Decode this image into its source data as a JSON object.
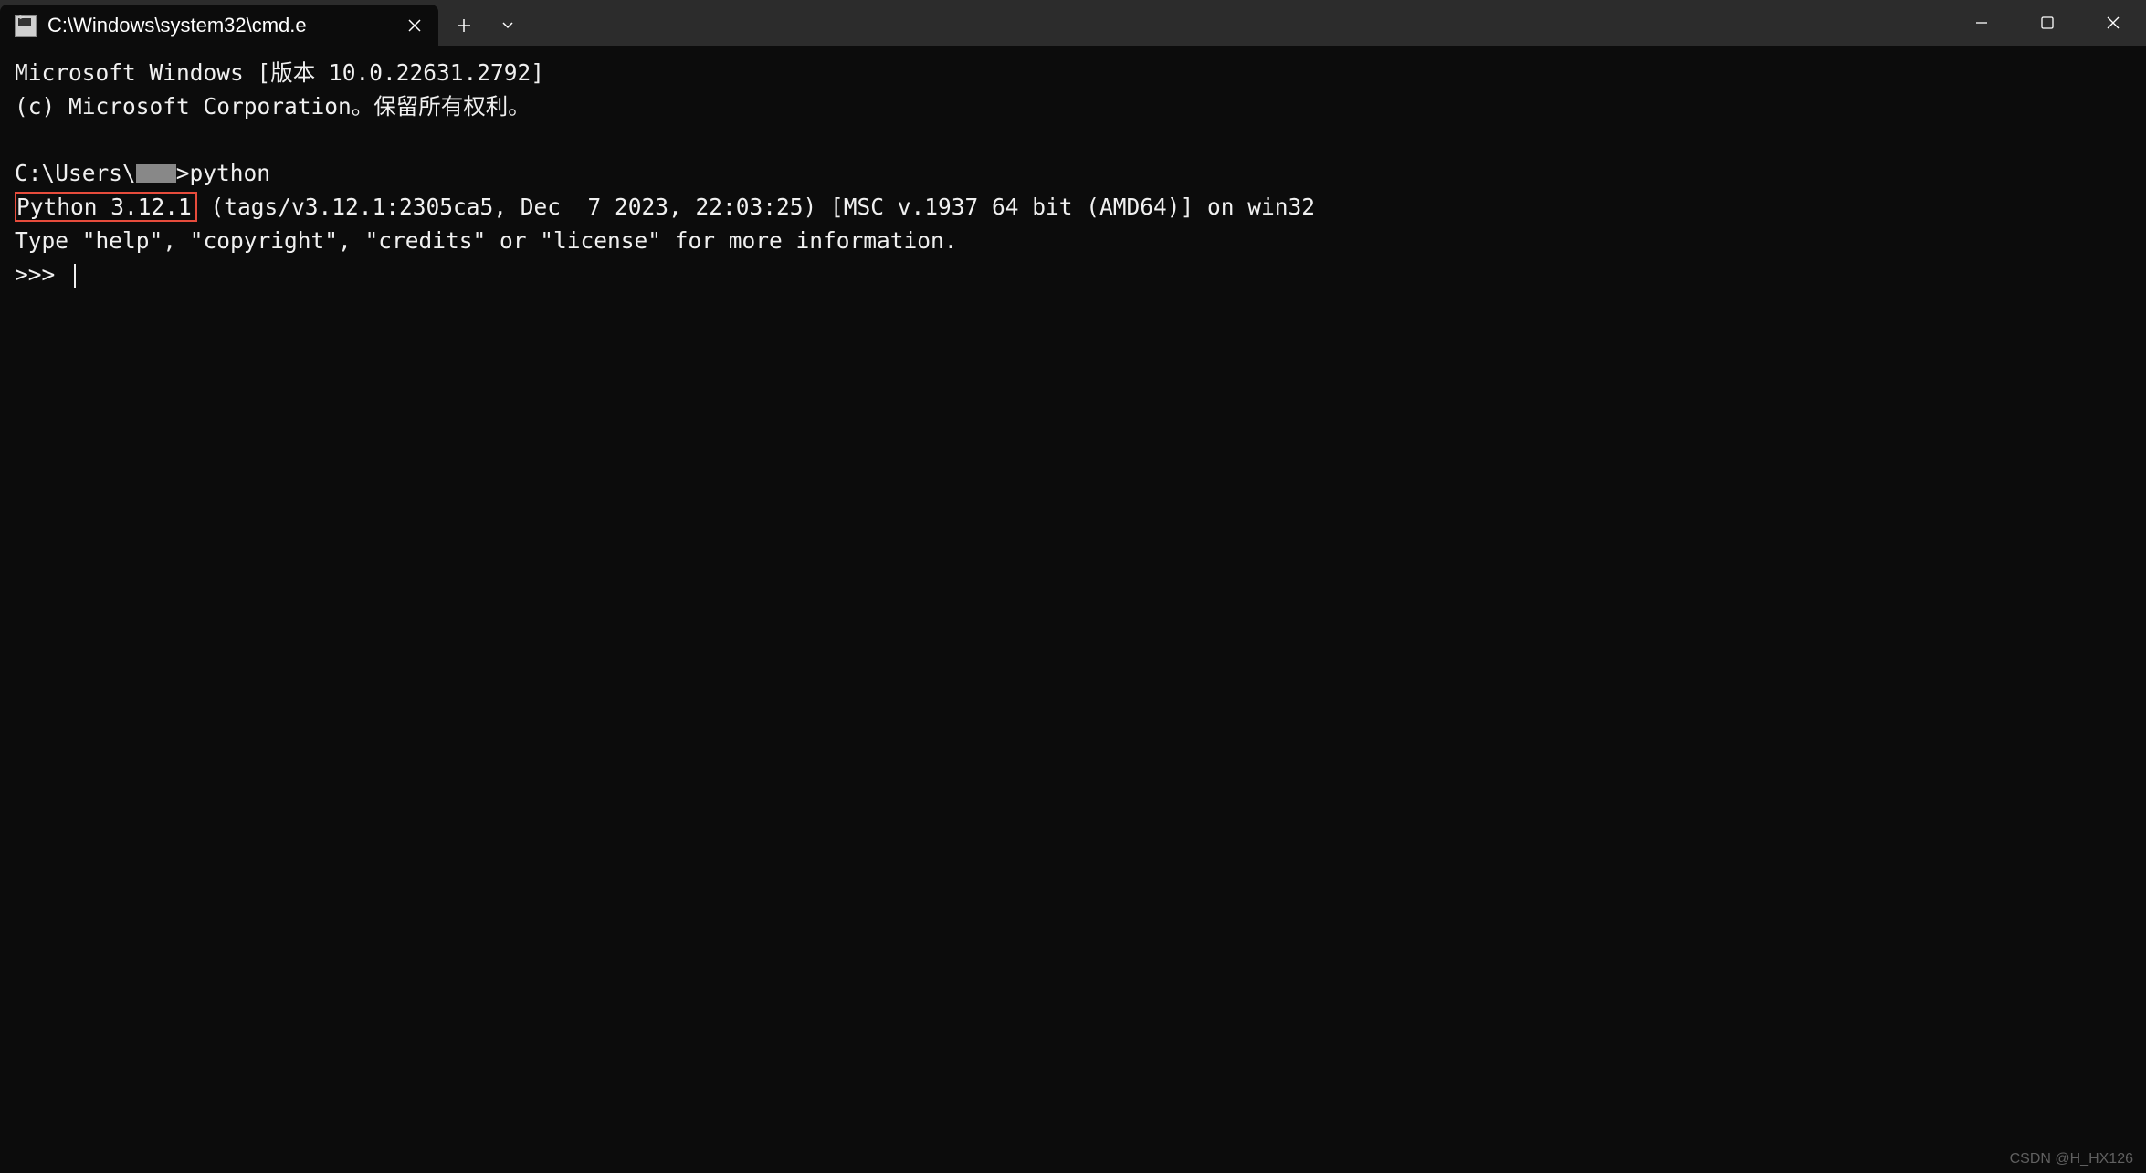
{
  "tab": {
    "title": "C:\\Windows\\system32\\cmd.e"
  },
  "terminal": {
    "line1": "Microsoft Windows [版本 10.0.22631.2792]",
    "line2": "(c) Microsoft Corporation。保留所有权利。",
    "blank": "",
    "prompt_prefix": "C:\\Users\\",
    "prompt_suffix": ">python",
    "highlighted": "Python 3.12.1",
    "version_rest": " (tags/v3.12.1:2305ca5, Dec  7 2023, 22:03:25) [MSC v.1937 64 bit (AMD64)] on win32",
    "help_line": "Type \"help\", \"copyright\", \"credits\" or \"license\" for more information.",
    "repl_prompt": ">>> "
  },
  "watermark": "CSDN @H_HX126"
}
